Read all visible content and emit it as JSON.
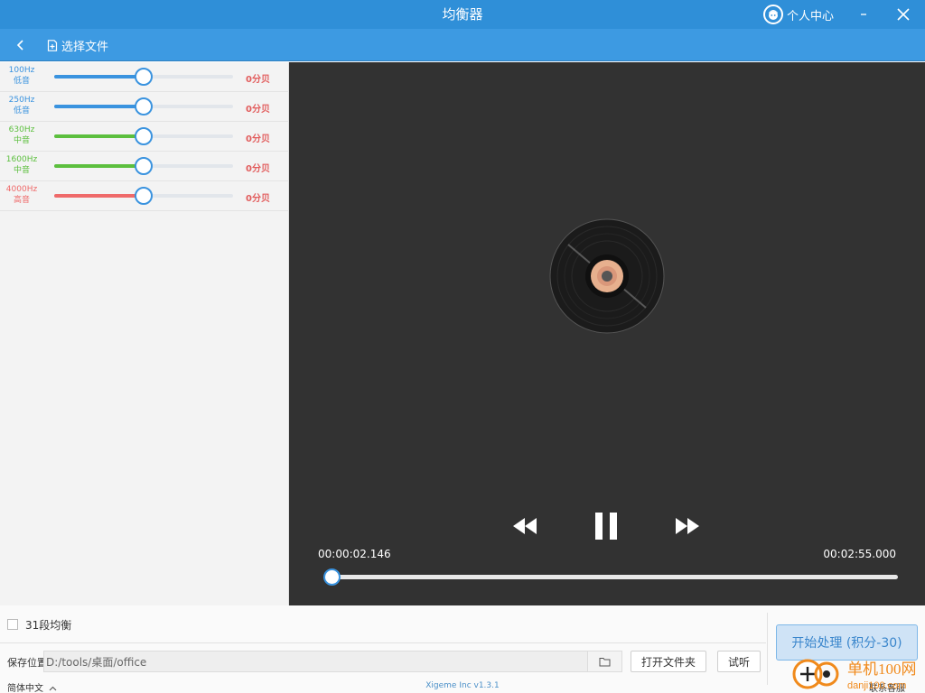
{
  "window": {
    "title": "均衡器",
    "user_center": "个人中心"
  },
  "toolbar": {
    "select_file": "选择文件"
  },
  "bands": [
    {
      "freq": "100Hz",
      "range": "低音",
      "gain_label": "0分贝",
      "level": 0.5,
      "color": "#3a93df"
    },
    {
      "freq": "250Hz",
      "range": "低音",
      "gain_label": "0分贝",
      "level": 0.5,
      "color": "#3a93df"
    },
    {
      "freq": "630Hz",
      "range": "中音",
      "gain_label": "0分贝",
      "level": 0.5,
      "color": "#5cbf3e"
    },
    {
      "freq": "1600Hz",
      "range": "中音",
      "gain_label": "0分贝",
      "level": 0.5,
      "color": "#5cbf3e"
    },
    {
      "freq": "4000Hz",
      "range": "高音",
      "gain_label": "0分贝",
      "level": 0.5,
      "color": "#ef6a6a"
    }
  ],
  "player": {
    "current_time": "00:00:02.146",
    "total_time": "00:02:55.000",
    "progress": 0.012
  },
  "bottom": {
    "eq31_label": "31段均衡",
    "eq31_checked": false,
    "save_label": "保存位置",
    "save_path": "D:/tools/桌面/office",
    "open_folder": "打开文件夹",
    "preview": "试听",
    "start": "开始处理 (积分-30)",
    "language": "简体中文",
    "version": "Xigeme Inc v1.3.1",
    "feedback": "联系客服"
  },
  "watermark": {
    "brand": "单机100网",
    "domain": "danji100.com"
  },
  "colors": {
    "titlebar": "#2f8fd8",
    "toolbar": "#3d9ae2",
    "player_bg": "#323232",
    "accent": "#3a93df"
  }
}
